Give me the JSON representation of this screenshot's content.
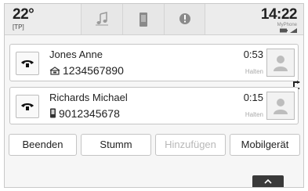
{
  "status_bar": {
    "temperature": "22°",
    "temperature_mode": "[TP]",
    "tabs": [
      {
        "name": "music-icon"
      },
      {
        "name": "phone-device-icon"
      },
      {
        "name": "info-icon"
      }
    ],
    "time": "14:22",
    "device_name": "MyPhone"
  },
  "calls": [
    {
      "caller": "Jones Anne",
      "number_type_icon": "home-phone-icon",
      "number": "1234567890",
      "duration": "0:53",
      "status": "Halten"
    },
    {
      "caller": "Richards Michael",
      "number_type_icon": "mobile-phone-icon",
      "number": "9012345678",
      "duration": "0:15",
      "status": "Halten"
    }
  ],
  "actions": {
    "end": "Beenden",
    "mute": "Stumm",
    "add": "Hinzufügen",
    "mobile": "Mobilgerät"
  },
  "colors": {
    "background": "#f6f6f6",
    "status_bar": "#ececec",
    "disabled_text": "#b8b8b8",
    "scroll_tab": "#3a3a3a"
  }
}
